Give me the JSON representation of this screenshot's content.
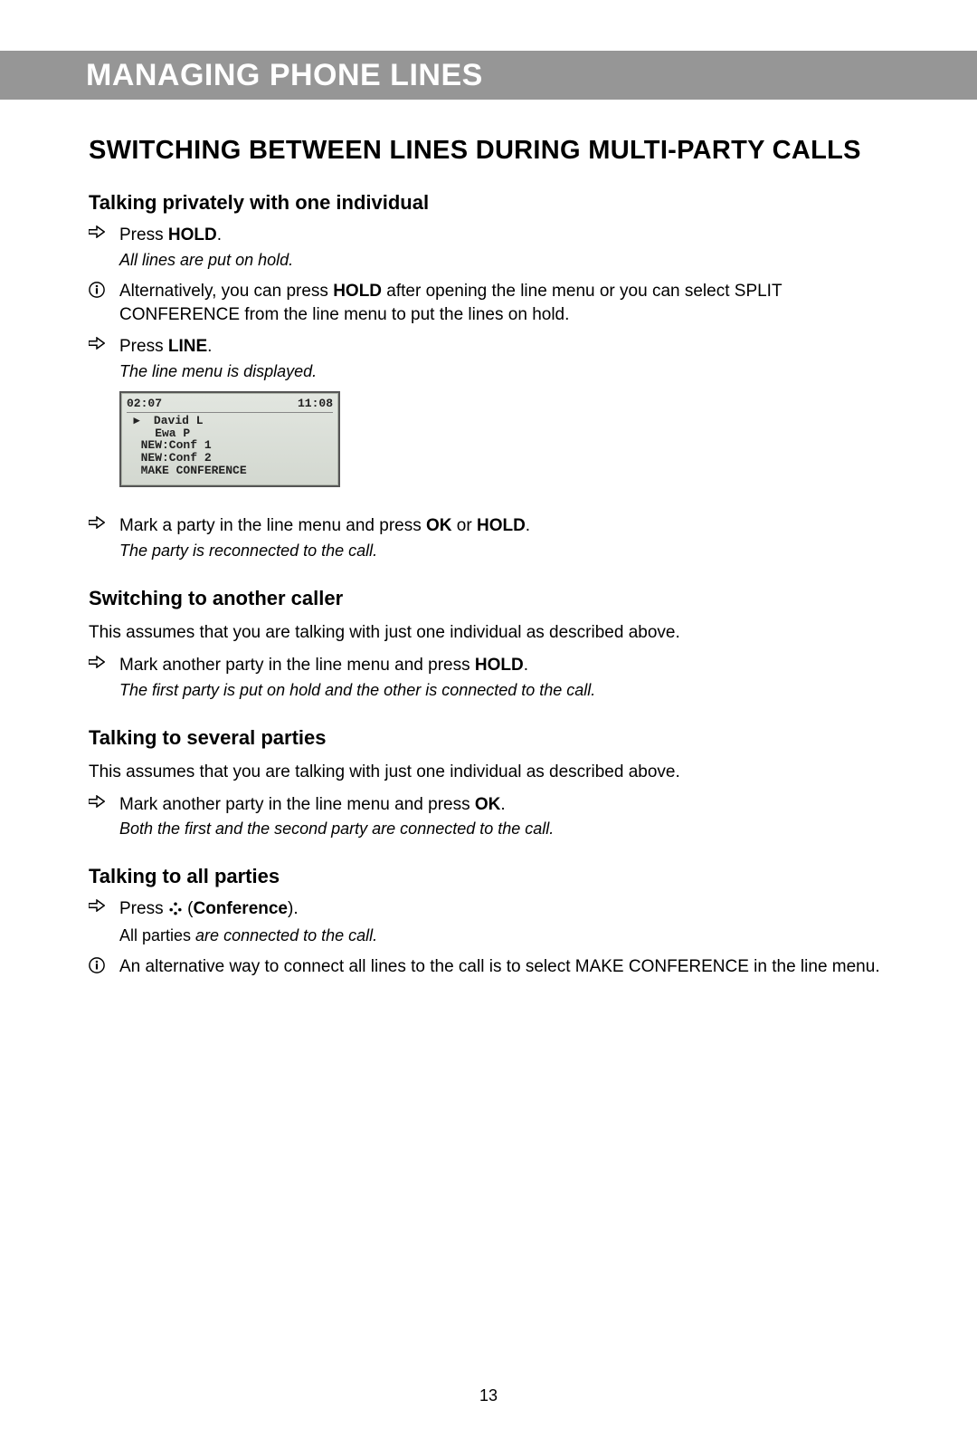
{
  "banner": "MANAGING PHONE LINES",
  "title": "SWITCHING BETWEEN LINES DURING MULTI-PARTY CALLS",
  "s1": {
    "heading": "Talking privately with one individual",
    "step1_pre": "Press ",
    "step1_bold": "HOLD",
    "step1_post": ".",
    "step1_note": "All lines are put on hold.",
    "info_pre": "Alternatively, you can press ",
    "info_bold": "HOLD",
    "info_post": " after opening the line menu or you can select SPLIT CONFERENCE from the line menu to put the lines on hold.",
    "step2_pre": "Press ",
    "step2_bold": "LINE",
    "step2_post": ".",
    "step2_note": "The line menu is displayed.",
    "lcd": {
      "left": "02:07",
      "right": "11:08",
      "l1": " ▸  David L",
      "l2": "    Ewa P",
      "l3": "  NEW:Conf 1",
      "l4": "  NEW:Conf 2",
      "l5": "  MAKE CONFERENCE"
    },
    "step3_pre": "Mark a party in the line menu and press ",
    "step3_b1": "OK",
    "step3_mid": " or ",
    "step3_b2": "HOLD",
    "step3_post": ".",
    "step3_note": "The party is reconnected to the call."
  },
  "s2": {
    "heading": "Switching to another caller",
    "para": "This assumes that you are talking with just one individual as described above.",
    "step_pre": "Mark another party in the line menu and press ",
    "step_bold": "HOLD",
    "step_post": ".",
    "step_note": "The first party is put on hold and the other is connected to the call."
  },
  "s3": {
    "heading": "Talking to several parties",
    "para": "This assumes that you are talking with just one individual as described above.",
    "step_pre": "Mark another party in the line menu and press ",
    "step_bold": "OK",
    "step_post": ".",
    "step_note": "Both the first and the second party are connected to the call."
  },
  "s4": {
    "heading": "Talking to all parties",
    "step_pre": "Press ",
    "step_b1": " (",
    "step_bold": "Conference",
    "step_b2": ").",
    "step_note_pre": "All parties ",
    "step_note_ital": "are connected to the call.",
    "info": "An alternative way to connect all lines to the call is to select MAKE CONFERENCE in the line menu."
  },
  "page": "13"
}
